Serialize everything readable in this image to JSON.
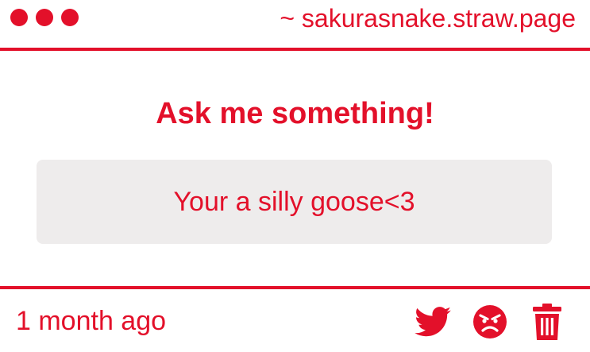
{
  "theme": {
    "accent": "#e3102a",
    "box_background": "#eeecec",
    "background": "#ffffff"
  },
  "window": {
    "url": "~ sakurasnake.straw.page",
    "controls": [
      "window-dot",
      "window-dot",
      "window-dot"
    ]
  },
  "prompt": {
    "heading": "Ask me something!"
  },
  "question": {
    "text": "Your a silly goose<3"
  },
  "footer": {
    "timestamp": "1 month ago",
    "actions": [
      {
        "icon": "twitter-bird-icon",
        "name": "share-twitter-button"
      },
      {
        "icon": "angry-face-icon",
        "name": "report-button"
      },
      {
        "icon": "trash-icon",
        "name": "delete-button"
      }
    ]
  }
}
